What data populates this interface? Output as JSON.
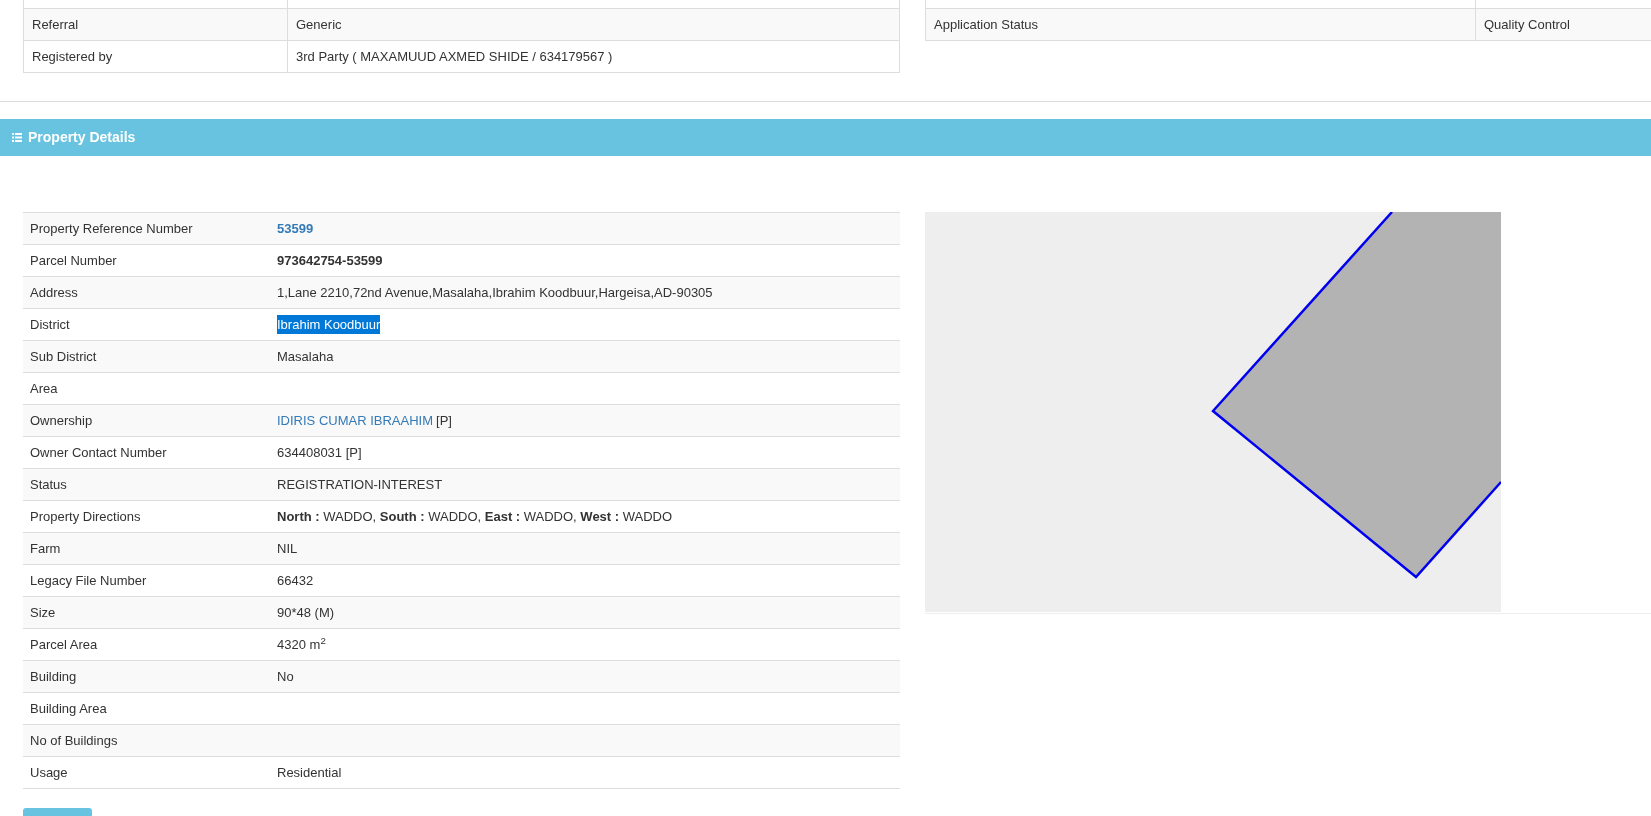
{
  "applicant_table": {
    "rows": [
      {
        "label": "Referral",
        "value": "Generic"
      },
      {
        "label": "Registered by",
        "value": "3rd Party ( MAXAMUUD AXMED SHIDE / 634179567 )"
      }
    ]
  },
  "application_table": {
    "rows": [
      {
        "label": "Application Status",
        "value": "Quality Control"
      }
    ]
  },
  "section_header": {
    "title": "Property Details"
  },
  "property_table": {
    "rows": [
      {
        "label": "Property Reference Number",
        "value": "53599",
        "kind": "link-bold"
      },
      {
        "label": "Parcel Number",
        "value": "973642754-53599",
        "kind": "bold"
      },
      {
        "label": "Address",
        "value": "1,Lane 2210,72nd Avenue,Masalaha,Ibrahim Koodbuur,Hargeisa,AD-90305",
        "kind": "plain"
      },
      {
        "label": "District",
        "value": "Ibrahim Koodbuur",
        "kind": "plain",
        "highlighted": true
      },
      {
        "label": "Sub District",
        "value": "Masalaha",
        "kind": "plain"
      },
      {
        "label": "Area"
      },
      {
        "label": "Ownership",
        "value": "IDIRIS CUMAR IBRAAHIM",
        "suffix": "[P]",
        "kind": "link"
      },
      {
        "label": "Owner Contact Number",
        "value": "634408031 [P]",
        "kind": "plain"
      },
      {
        "label": "Status",
        "value": "REGISTRATION-INTEREST",
        "kind": "plain"
      },
      {
        "label": "Property Directions",
        "value": "**North :** WADDO, **South :** WADDO, **East :** WADDO, **West :** WADDO",
        "kind": "plain"
      },
      {
        "label": "Farm",
        "value": "NIL",
        "kind": "plain"
      },
      {
        "label": "Legacy File Number",
        "value": "66432",
        "kind": "plain"
      },
      {
        "label": "Size",
        "value": "90*48 (M)",
        "kind": "plain"
      },
      {
        "label": "Parcel Area",
        "value": "4320 m$^{2}$",
        "kind": "plain"
      },
      {
        "label": "Building",
        "value": "No",
        "kind": "plain"
      },
      {
        "label": "Building Area"
      },
      {
        "label": "No of Buildings"
      },
      {
        "label": "Usage",
        "value": "Residential",
        "kind": "plain"
      }
    ]
  },
  "parcel_map": {
    "kind": "map"
  }
}
